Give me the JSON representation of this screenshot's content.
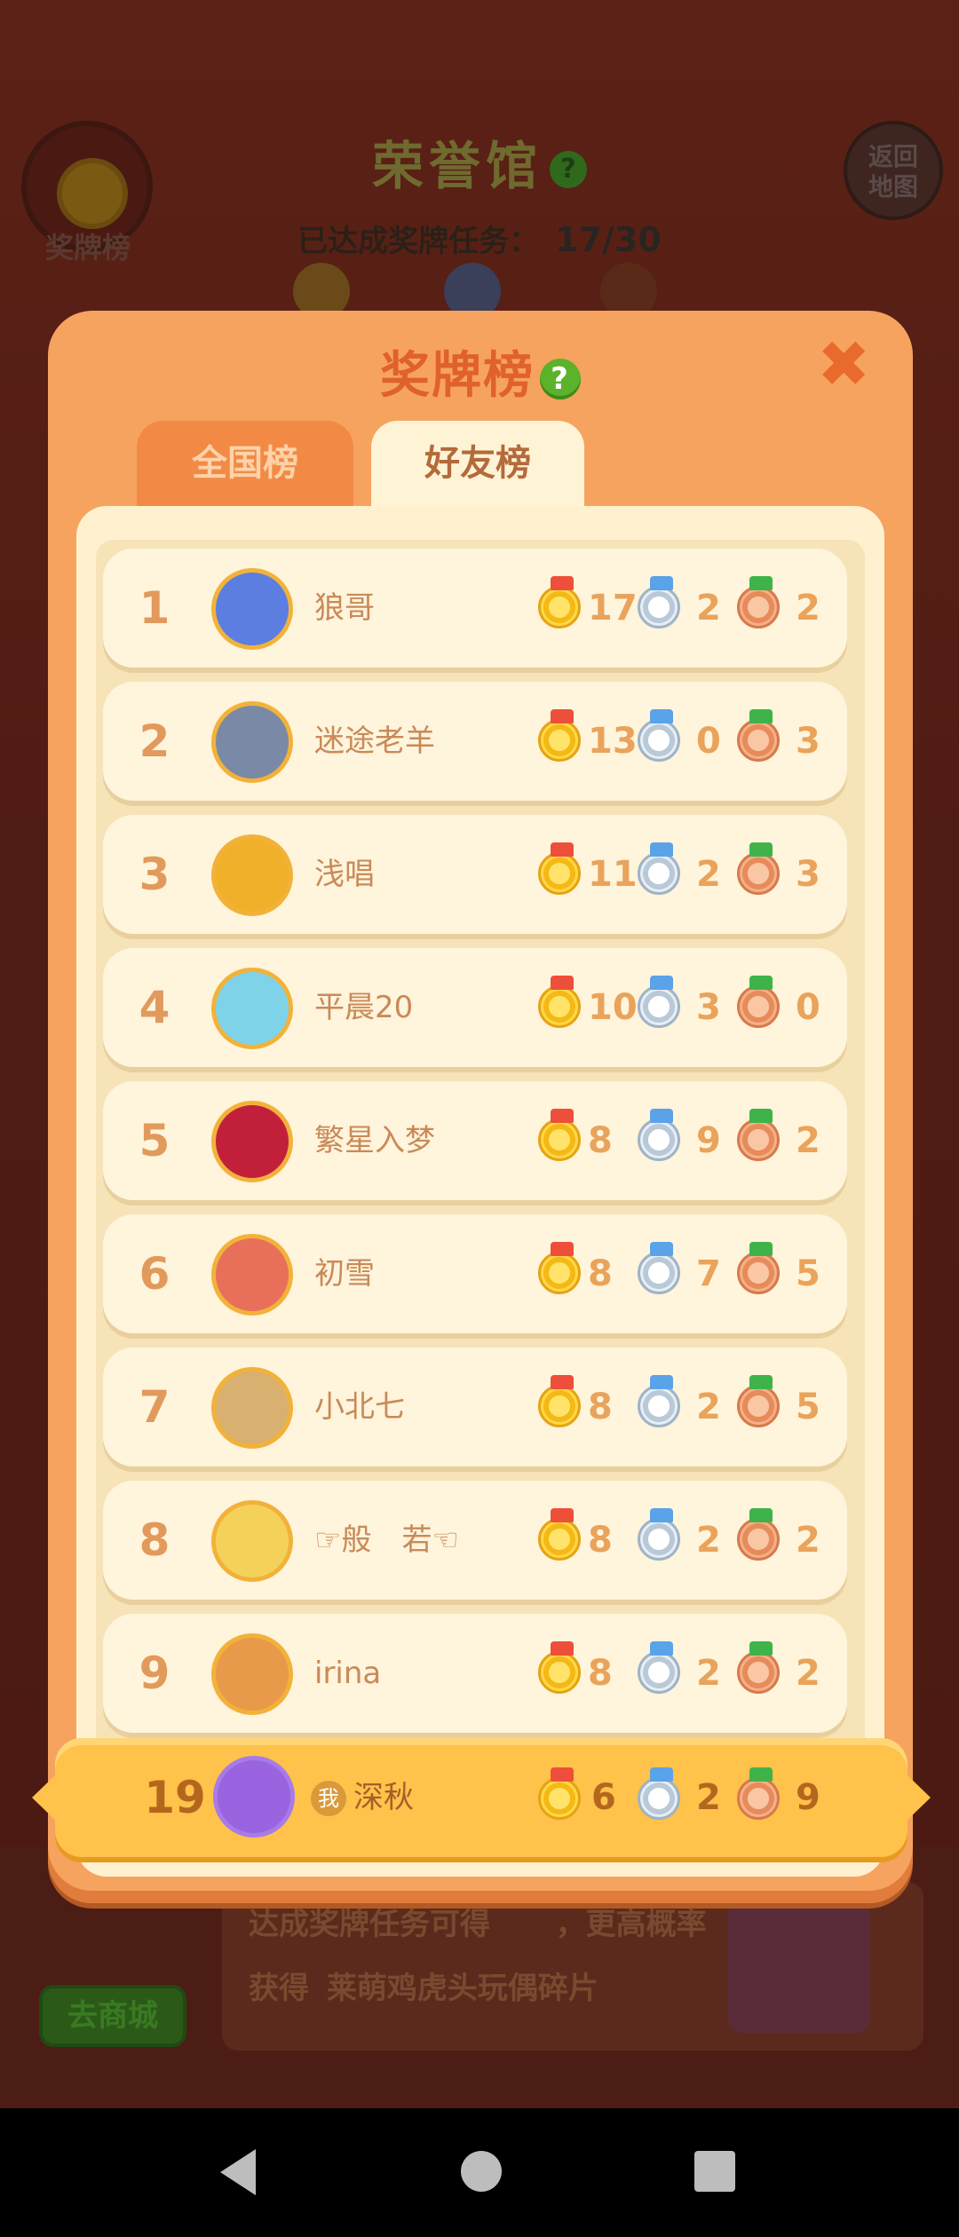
{
  "background": {
    "title": "荣誉馆",
    "help_glyph": "?",
    "medal_board_label": "奖牌榜",
    "return_line1": "返回",
    "return_line2": "地图",
    "progress_label": "已达成奖牌任务：",
    "progress_value": "17/30",
    "hint_line1": "达成奖牌任务可得",
    "hint_line1_suffix": "，更高概率",
    "hint_line2_prefix": "获得",
    "hint_line2_item": "莱萌鸡虎头玩偶碎片",
    "shop_button": "去商城"
  },
  "modal": {
    "title": "奖牌榜",
    "help_glyph": "?",
    "close_glyph": "✖",
    "tabs": [
      {
        "label": "全国榜",
        "selected": false
      },
      {
        "label": "好友榜",
        "selected": true
      }
    ]
  },
  "rows": [
    {
      "rank": "1",
      "name": "狼哥",
      "gold": "17",
      "silver": "2",
      "bronze": "2",
      "avatar_color": "#5b7ee0"
    },
    {
      "rank": "2",
      "name": "迷途老羊",
      "gold": "13",
      "silver": "0",
      "bronze": "3",
      "avatar_color": "#7a8aa6"
    },
    {
      "rank": "3",
      "name": "浅唱",
      "gold": "11",
      "silver": "2",
      "bronze": "3",
      "avatar_color": "#f0b02a"
    },
    {
      "rank": "4",
      "name": "平晨20",
      "gold": "10",
      "silver": "3",
      "bronze": "0",
      "avatar_color": "#7ed3e8"
    },
    {
      "rank": "5",
      "name": "繁星入梦",
      "gold": "8",
      "silver": "9",
      "bronze": "2",
      "avatar_color": "#c2203a"
    },
    {
      "rank": "6",
      "name": "初雪",
      "gold": "8",
      "silver": "7",
      "bronze": "5",
      "avatar_color": "#e8705a"
    },
    {
      "rank": "7",
      "name": "小北七",
      "gold": "8",
      "silver": "2",
      "bronze": "5",
      "avatar_color": "#d8b070"
    },
    {
      "rank": "8",
      "name": "☞般　若☜",
      "gold": "8",
      "silver": "2",
      "bronze": "2",
      "avatar_color": "#f4d25a"
    },
    {
      "rank": "9",
      "name": "irina",
      "gold": "8",
      "silver": "2",
      "bronze": "2",
      "avatar_color": "#e89a4a"
    }
  ],
  "self_row": {
    "rank": "19",
    "me_badge": "我",
    "name": "深秋",
    "gold": "6",
    "silver": "2",
    "bronze": "9"
  },
  "colors": {
    "modal_orange": "#f6a35f",
    "title_orange": "#e0612a",
    "self_yellow": "#ffc24a"
  }
}
